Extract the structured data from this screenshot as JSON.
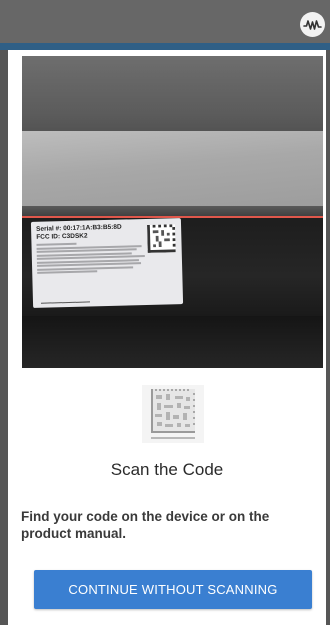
{
  "camera": {
    "label": {
      "serial_line": "Serial #: 00:17:1A:B3:B5:8D",
      "fcc_line": "FCC ID: C3DSK2"
    }
  },
  "dialog": {
    "title": "Scan the Code",
    "instruction": "Find your code on the device or on the product manual.",
    "continue_button": "CONTINUE WITHOUT SCANNING"
  },
  "colors": {
    "accent": "#2f5f86",
    "button": "#3a7fd1",
    "scan_line": "#e0574b"
  },
  "icons": {
    "app_logo": "waveform-logo",
    "code_sample": "datamatrix-code"
  }
}
